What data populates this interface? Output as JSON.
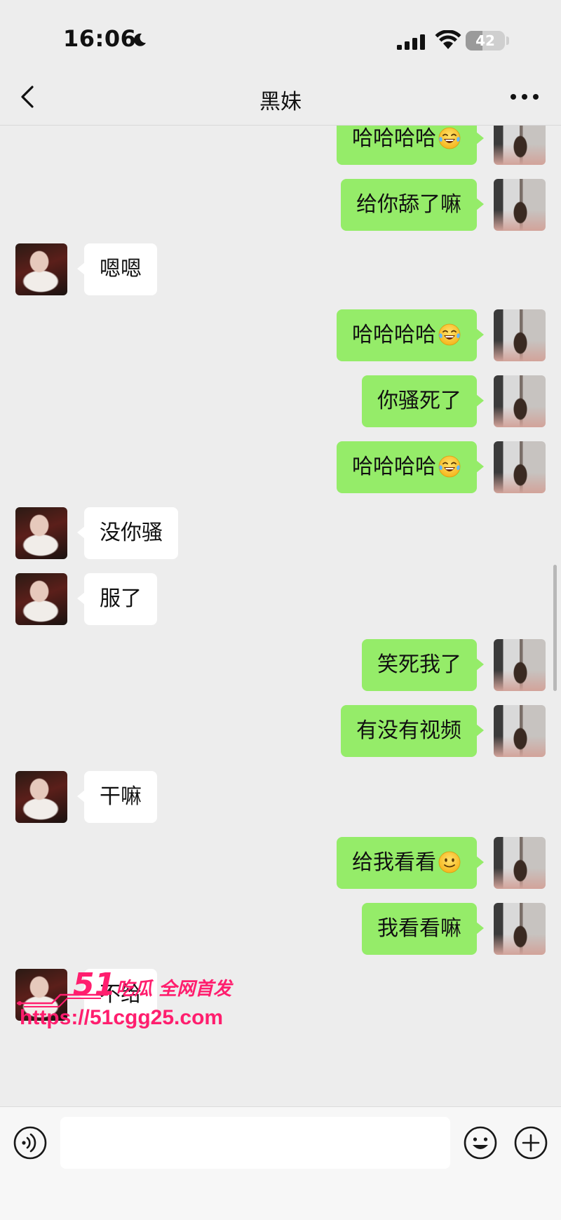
{
  "status_bar": {
    "time": "16:06",
    "battery": "42",
    "battery_level": 0.42,
    "icons": [
      "moon-icon",
      "signal-icon",
      "wifi-icon",
      "battery-icon"
    ]
  },
  "nav": {
    "title": "黑妹",
    "back_icon": "chevron-left-icon",
    "more_icon": "more-dots-icon"
  },
  "messages": [
    {
      "sender": "self",
      "text": "哈哈哈哈",
      "emoji": "tears-of-joy"
    },
    {
      "sender": "self",
      "text": "给你舔了嘛"
    },
    {
      "sender": "friend",
      "text": "嗯嗯"
    },
    {
      "sender": "self",
      "text": "哈哈哈哈",
      "emoji": "tears-of-joy"
    },
    {
      "sender": "self",
      "text": "你骚死了"
    },
    {
      "sender": "self",
      "text": "哈哈哈哈",
      "emoji": "tears-of-joy"
    },
    {
      "sender": "friend",
      "text": "没你骚"
    },
    {
      "sender": "friend",
      "text": "服了"
    },
    {
      "sender": "self",
      "text": "笑死我了"
    },
    {
      "sender": "self",
      "text": "有没有视频"
    },
    {
      "sender": "friend",
      "text": "干嘛"
    },
    {
      "sender": "self",
      "text": "给我看看",
      "emoji": "smile"
    },
    {
      "sender": "self",
      "text": "我看看嘛"
    },
    {
      "sender": "friend",
      "text": "不给"
    }
  ],
  "watermark": {
    "brand_number": "51",
    "brand_text": "吃瓜 全网首发",
    "url": "https://51cgg25.com"
  },
  "input_bar": {
    "value": "",
    "icons": [
      "voice-icon",
      "emoji-icon",
      "plus-icon"
    ]
  },
  "colors": {
    "background": "#ededed",
    "self_bubble": "#95ec69",
    "friend_bubble": "#ffffff",
    "watermark": "#ff1e6e"
  }
}
